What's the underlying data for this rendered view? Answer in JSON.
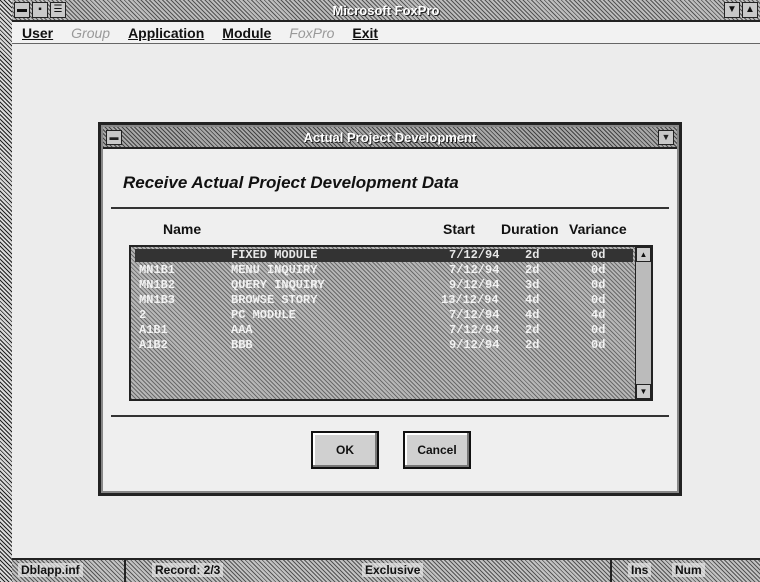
{
  "window": {
    "title": "Microsoft FoxPro"
  },
  "menu": {
    "items": [
      {
        "label": "User",
        "enabled": true
      },
      {
        "label": "Group",
        "enabled": false
      },
      {
        "label": "Application",
        "enabled": true
      },
      {
        "label": "Module",
        "enabled": true
      },
      {
        "label": "FoxPro",
        "enabled": false
      },
      {
        "label": "Exit",
        "enabled": true
      }
    ]
  },
  "dialog": {
    "title": "Actual Project Development",
    "heading": "Receive Actual Project Development Data",
    "columns": {
      "name": "Name",
      "start": "Start",
      "duration": "Duration",
      "variance": "Variance"
    },
    "rows": [
      {
        "code": "",
        "module": "FIXED MODULE",
        "start": "7/12/94",
        "duration": "2d",
        "variance": "0d",
        "selected": true
      },
      {
        "code": "MN1B1",
        "module": "MENU INQUIRY",
        "start": "7/12/94",
        "duration": "2d",
        "variance": "0d",
        "selected": false
      },
      {
        "code": "MN1B2",
        "module": "QUERY INQUIRY",
        "start": "9/12/94",
        "duration": "3d",
        "variance": "0d",
        "selected": false
      },
      {
        "code": "MN1B3",
        "module": "BROWSE STORY",
        "start": "13/12/94",
        "duration": "4d",
        "variance": "0d",
        "selected": false
      },
      {
        "code": "2",
        "module": "PC MODULE",
        "start": "7/12/94",
        "duration": "4d",
        "variance": "4d",
        "selected": false
      },
      {
        "code": "A1B1",
        "module": "AAA",
        "start": "7/12/94",
        "duration": "2d",
        "variance": "0d",
        "selected": false
      },
      {
        "code": "A1B2",
        "module": "BBB",
        "start": "9/12/94",
        "duration": "2d",
        "variance": "0d",
        "selected": false
      }
    ],
    "ok_label": "OK",
    "cancel_label": "Cancel"
  },
  "status": {
    "file": "Dblapp.inf",
    "record": "Record: 2/3",
    "mode": "Exclusive",
    "ins": "Ins",
    "num": "Num"
  },
  "icons": {
    "system_menu": "system-menu-icon",
    "minimize": "minimize-icon",
    "maximize": "maximize-icon",
    "scroll_up": "scroll-up-icon",
    "scroll_down": "scroll-down-icon"
  }
}
